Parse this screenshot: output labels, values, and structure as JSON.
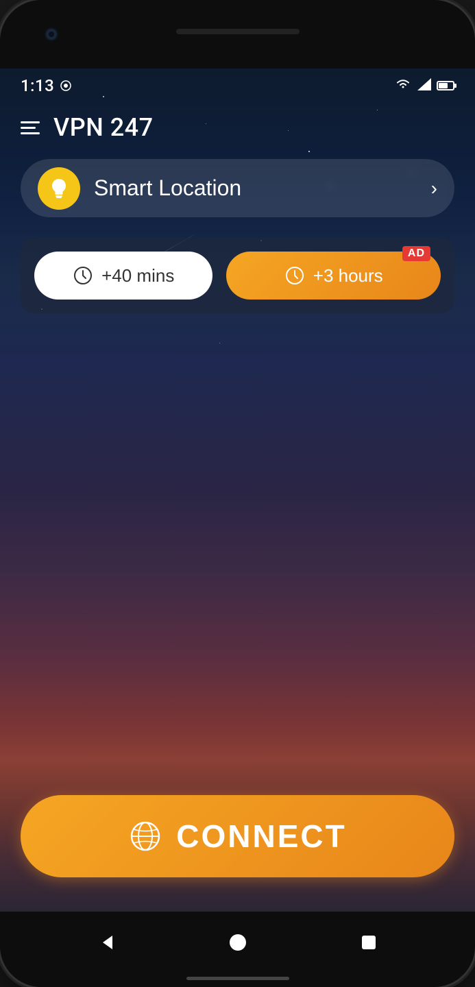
{
  "phone": {
    "status_bar": {
      "time": "1:13",
      "icons": {
        "wifi": "wifi-icon",
        "signal": "signal-icon",
        "battery": "battery-icon"
      }
    },
    "app": {
      "title": "VPN 247",
      "menu_icon": "hamburger-icon",
      "location": {
        "label": "Smart Location",
        "icon": "lightbulb-icon",
        "arrow": "›"
      },
      "timer": {
        "option1_label": "+40 mins",
        "option2_label": "+3 hours",
        "ad_badge": "AD"
      },
      "connect_button": {
        "label": "CONNECT",
        "icon": "globe-icon"
      }
    },
    "nav": {
      "back_icon": "◀",
      "home_icon": "●",
      "recent_icon": "■"
    }
  }
}
